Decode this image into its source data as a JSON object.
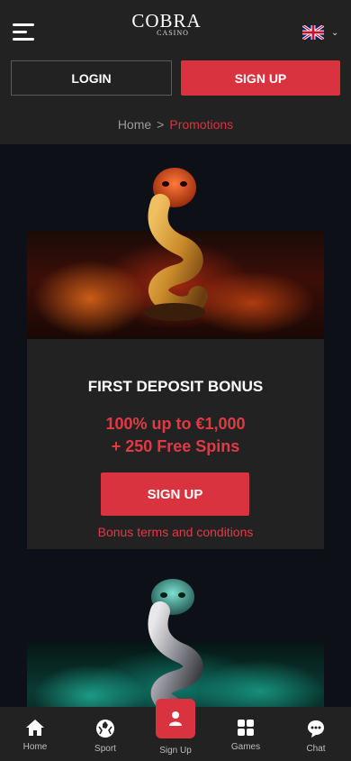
{
  "header": {
    "logo_main": "COBRA",
    "logo_sub": "CASINO",
    "language_icon": "uk-flag-icon",
    "login_label": "LOGIN",
    "signup_label": "SIGN UP"
  },
  "breadcrumb": {
    "home": "Home",
    "separator": ">",
    "current": "Promotions"
  },
  "promo": {
    "title": "FIRST DEPOSIT BONUS",
    "offer_line1": "100% up to €1,000",
    "offer_line2": "+ 250 Free Spins",
    "cta_label": "SIGN UP",
    "terms_label": "Bonus terms and conditions"
  },
  "bottom_nav": {
    "items": [
      {
        "label": "Home",
        "icon": "home-icon"
      },
      {
        "label": "Sport",
        "icon": "soccer-ball-icon"
      },
      {
        "label": "Sign Up",
        "icon": "user-icon"
      },
      {
        "label": "Games",
        "icon": "grid-icon"
      },
      {
        "label": "Chat",
        "icon": "chat-bubble-icon"
      }
    ]
  },
  "colors": {
    "accent": "#d9333f",
    "accent_text": "#e23a45",
    "header_bg": "#222222",
    "page_bg": "#0d1117"
  }
}
